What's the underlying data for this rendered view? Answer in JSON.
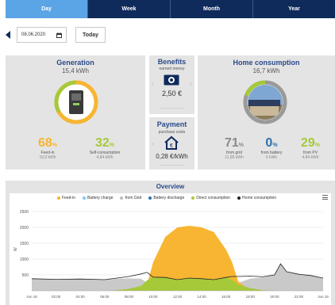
{
  "tabs": [
    {
      "label": "Day",
      "active": true
    },
    {
      "label": "Week",
      "active": false
    },
    {
      "label": "Month",
      "active": false
    },
    {
      "label": "Year",
      "active": false
    }
  ],
  "datebar": {
    "date_value": "08.06.2020",
    "today_label": "Today"
  },
  "generation": {
    "title": "Generation",
    "total": "15,4 kWh",
    "feed_in": {
      "value": "68",
      "unit": "%",
      "label": "Feed-in",
      "sub": "10,6 kWh"
    },
    "self_consumption": {
      "value": "32",
      "unit": "%",
      "label": "Self-consumption",
      "sub": "4,84 kWh"
    }
  },
  "benefits": {
    "title": "Benefits",
    "subtitle": "earned money",
    "value": "2,50 €"
  },
  "payment": {
    "title": "Payment",
    "subtitle": "purchase costs",
    "value": "0,28 €/kWh"
  },
  "home": {
    "title": "Home consumption",
    "total": "16,7 kWh",
    "from_grid": {
      "value": "71",
      "unit": "%",
      "label": "from grid",
      "sub": "11,85 kWh"
    },
    "from_battery": {
      "value": "0",
      "unit": "%",
      "label": "from battery",
      "sub": "0 kWh"
    },
    "from_pv": {
      "value": "29",
      "unit": "%",
      "label": "from PV",
      "sub": "4,84 kWh"
    }
  },
  "overview": {
    "title": "Overview",
    "legend": [
      {
        "label": "Feed-in",
        "color": "#f7b532"
      },
      {
        "label": "Battery charge",
        "color": "#7ec8ec"
      },
      {
        "label": "from Grid",
        "color": "#bdbdbd"
      },
      {
        "label": "Battery discharge",
        "color": "#2e6fae"
      },
      {
        "label": "Direct consumption",
        "color": "#a6c93a"
      },
      {
        "label": "Home consumption",
        "color": "#222222"
      }
    ]
  },
  "colors": {
    "tab_active": "#5ba4e6",
    "tab_inactive": "#0f2b5b",
    "accent_orange": "#f7b532",
    "accent_green": "#a6c93a",
    "grid_gray": "#9a9a9a",
    "battery_blue": "#2e6fae",
    "title_blue": "#2a4a8a"
  },
  "chart_data": {
    "type": "area",
    "ylabel": "W",
    "ylim": [
      0,
      2700
    ],
    "yticks": [
      "500",
      "1000",
      "1500",
      "2000",
      "2500"
    ],
    "xticks": [
      "Jun 18",
      "02:00",
      "04:00",
      "06:00",
      "08:00",
      "10:00",
      "12:00",
      "14:00",
      "16:00",
      "18:00",
      "20:00",
      "22:00",
      "Jun 19"
    ],
    "x_hours": [
      0,
      2,
      4,
      6,
      7,
      8,
      9,
      9.5,
      10,
      11,
      12,
      13,
      14,
      15,
      16,
      16.5,
      17,
      18,
      19,
      20,
      20.5,
      21,
      22,
      23,
      24
    ],
    "series": [
      {
        "name": "Feed-in",
        "color": "#f7b532",
        "values": [
          0,
          0,
          0,
          0,
          0,
          0,
          0,
          200,
          900,
          1700,
          2000,
          2050,
          2000,
          1850,
          1300,
          900,
          300,
          0,
          0,
          0,
          0,
          0,
          0,
          0,
          0
        ]
      },
      {
        "name": "from Grid",
        "color": "#bdbdbd",
        "values": [
          380,
          360,
          370,
          350,
          380,
          390,
          380,
          250,
          0,
          0,
          0,
          0,
          0,
          0,
          0,
          100,
          250,
          380,
          420,
          500,
          850,
          600,
          520,
          480,
          400
        ]
      },
      {
        "name": "Direct consumption",
        "color": "#a6c93a",
        "values": [
          0,
          0,
          0,
          0,
          20,
          60,
          150,
          330,
          430,
          420,
          350,
          400,
          380,
          350,
          420,
          350,
          200,
          80,
          20,
          0,
          0,
          0,
          0,
          0,
          0
        ]
      },
      {
        "name": "Home consumption",
        "color": "#222222",
        "values": [
          380,
          360,
          370,
          350,
          400,
          450,
          530,
          580,
          430,
          420,
          350,
          400,
          380,
          350,
          420,
          450,
          450,
          460,
          440,
          500,
          850,
          600,
          520,
          480,
          400
        ]
      }
    ]
  }
}
